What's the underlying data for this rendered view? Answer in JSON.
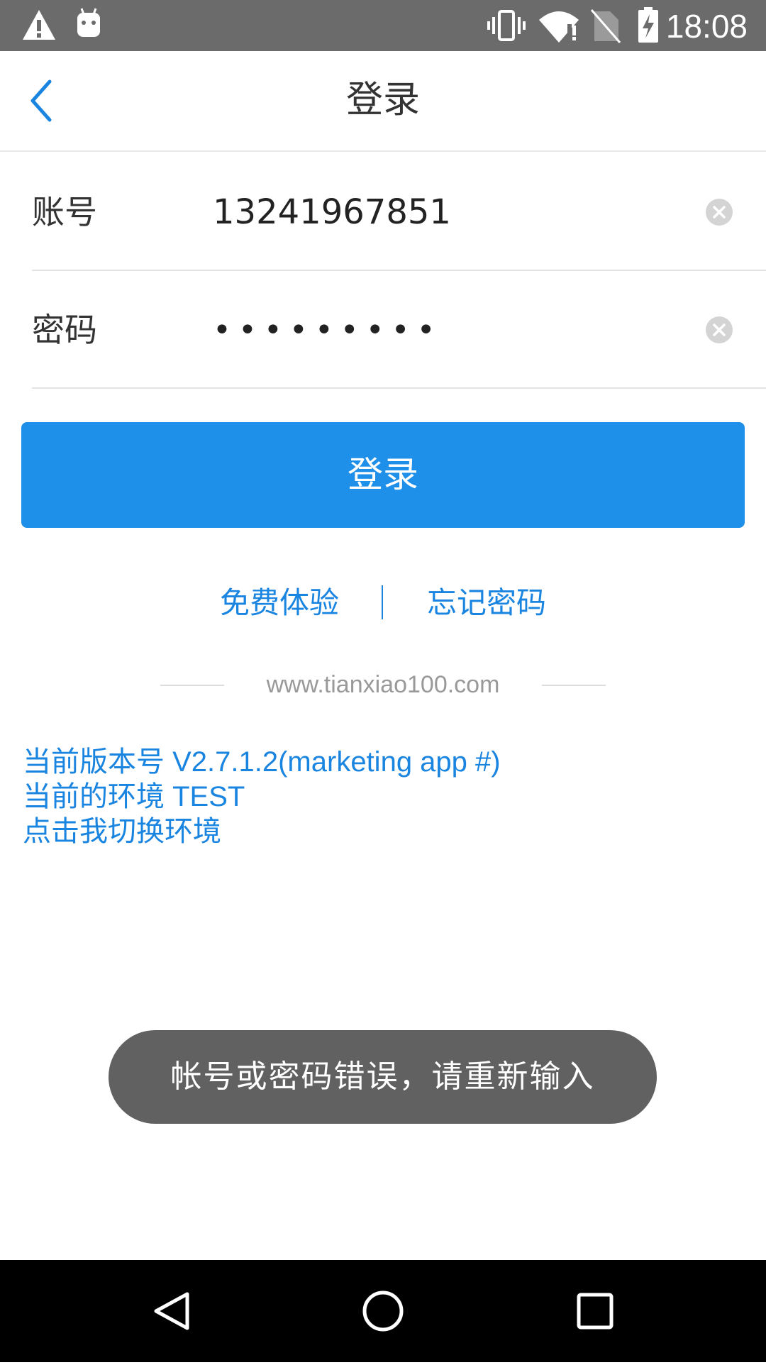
{
  "status_bar": {
    "time": "18:08",
    "icons": [
      "warning-icon",
      "android-icon",
      "vibrate-icon",
      "wifi-icon",
      "no-sim-icon",
      "battery-charging-icon"
    ]
  },
  "toolbar": {
    "title": "登录",
    "back_icon": "chevron-left-icon"
  },
  "form": {
    "account": {
      "label": "账号",
      "value": "13241967851"
    },
    "password": {
      "label": "密码",
      "value": "•••••••••"
    }
  },
  "login_button": {
    "label": "登录"
  },
  "links": {
    "free_trial": "免费体验",
    "forgot_password": "忘记密码"
  },
  "website": "www.tianxiao100.com",
  "env_info": {
    "version": "当前版本号 V2.7.1.2(marketing app #)",
    "environment": "当前的环境 TEST",
    "switch": "点击我切换环境"
  },
  "toast": {
    "message": "帐号或密码错误，请重新输入"
  },
  "colors": {
    "accent": "#1e90ea",
    "link": "#1a85e0",
    "status_bar": "#6b6b6b",
    "toast_bg": "#616161"
  }
}
